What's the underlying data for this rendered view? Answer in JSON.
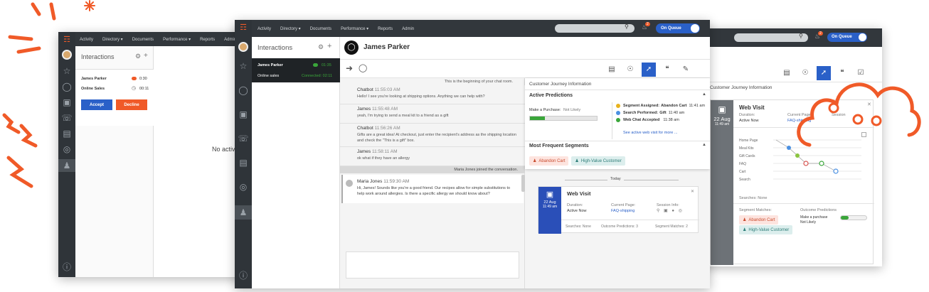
{
  "nav": {
    "items": [
      "Activity",
      "Directory ▾",
      "Documents",
      "Performance ▾",
      "Reports",
      "Admin"
    ],
    "on_queue": "On Queue",
    "notif_count": "2"
  },
  "left_window": {
    "interactions_title": "Interactions",
    "row1_name": "James Parker",
    "row1_time": "0:30",
    "row2_name": "Online Sales",
    "row2_time": "00:11",
    "accept": "Accept",
    "decline": "Decline",
    "no_active": "No active"
  },
  "main_window": {
    "interactions_title": "Interactions",
    "active_name": "James Parker",
    "active_time": "01:35",
    "active_queue": "Online sales",
    "active_status": "Connected: 02:11",
    "contact_name": "James Parker",
    "chat_start": "This is the beginning of your chat room.",
    "messages": [
      {
        "name": "Chatbot",
        "time": "11:55:03 AM",
        "text": "Hello! I see you're looking at shipping options. Anything we can help with?"
      },
      {
        "name": "James",
        "time": "11:55:48 AM",
        "text": "yeah, I'm trying to send a meal kit to a friend as a gift"
      },
      {
        "name": "Chatbot",
        "time": "11:56:26 AM",
        "text": "Gifts are a great idea! At checkout, just enter the recipient's address as the shipping location and check the \"This is a gift\" box."
      },
      {
        "name": "James",
        "time": "11:58:11 AM",
        "text": "ok what if they have an allergy"
      }
    ],
    "joined_notice": "Maria Jones joined the conversation.",
    "maria": {
      "name": "Maria Jones",
      "time": "11:59:30 AM",
      "text": "Hi, James! Sounds like you're a good friend. Our recipes allow for simple substitutions to help work around allergies. Is there a specific allergy we should know about?"
    },
    "journey": {
      "header": "Customer Journey Information",
      "active_predictions": "Active Predictions",
      "make_purchase": "Make a Purchase:",
      "not_likely": "Not Likely",
      "purchase_fill": 0.22,
      "events": [
        {
          "label": "Segment Assigned:",
          "value": "Abandon Cart",
          "time": "11:41 am",
          "color": "#e8b21c"
        },
        {
          "label": "Search Performed:",
          "value": "Gift",
          "time": "11:40 am",
          "color": "#4a90e2"
        },
        {
          "label": "Web Chat Accepted",
          "value": "",
          "time": "11:38 am",
          "color": "#3aa63a"
        }
      ],
      "see_more": "See active web visit for more ...",
      "frequent_segments": "Most Frequent Segments",
      "seg1": "Abandon Cart",
      "seg2": "High-Value Customer",
      "today": "Today",
      "card": {
        "date_day": "22 Aug",
        "date_time": "11:49 am",
        "title": "Web Visit",
        "duration_label": "Duration:",
        "duration_value": "Active Now",
        "page_label": "Current Page:",
        "page_value": "FAQ-shipping",
        "session_label": "Session Info:",
        "searches": "Searches: None",
        "outcome": "Outcome Predictions: 3",
        "segments": "Segment Matches: 2"
      }
    }
  },
  "right_window": {
    "journey_header": "Customer Journey Information",
    "date_day": "22 Aug",
    "date_time": "11:49 am",
    "title": "Web Visit",
    "duration_label": "Duration:",
    "duration_value": "Active Now",
    "page_label": "Current Page:",
    "page_value": "FAQ-shipping",
    "session_label": "Session",
    "pages": [
      "Home Page",
      "Meal Kits",
      "Gift Cards",
      "FAQ",
      "Cart",
      "Search"
    ],
    "searches": "Searches: None",
    "segment_matches": "Segment Matches:",
    "outcome_predictions": "Outcome Predictions",
    "seg1": "Abandon Cart",
    "seg2": "High-Value Customer",
    "make_purchase": "Make a purchase",
    "not_likely": "Not Likely"
  },
  "colors": {
    "accent": "#2a60c8",
    "orange": "#f05a28",
    "green": "#3aa63a",
    "dark": "#32373c"
  }
}
